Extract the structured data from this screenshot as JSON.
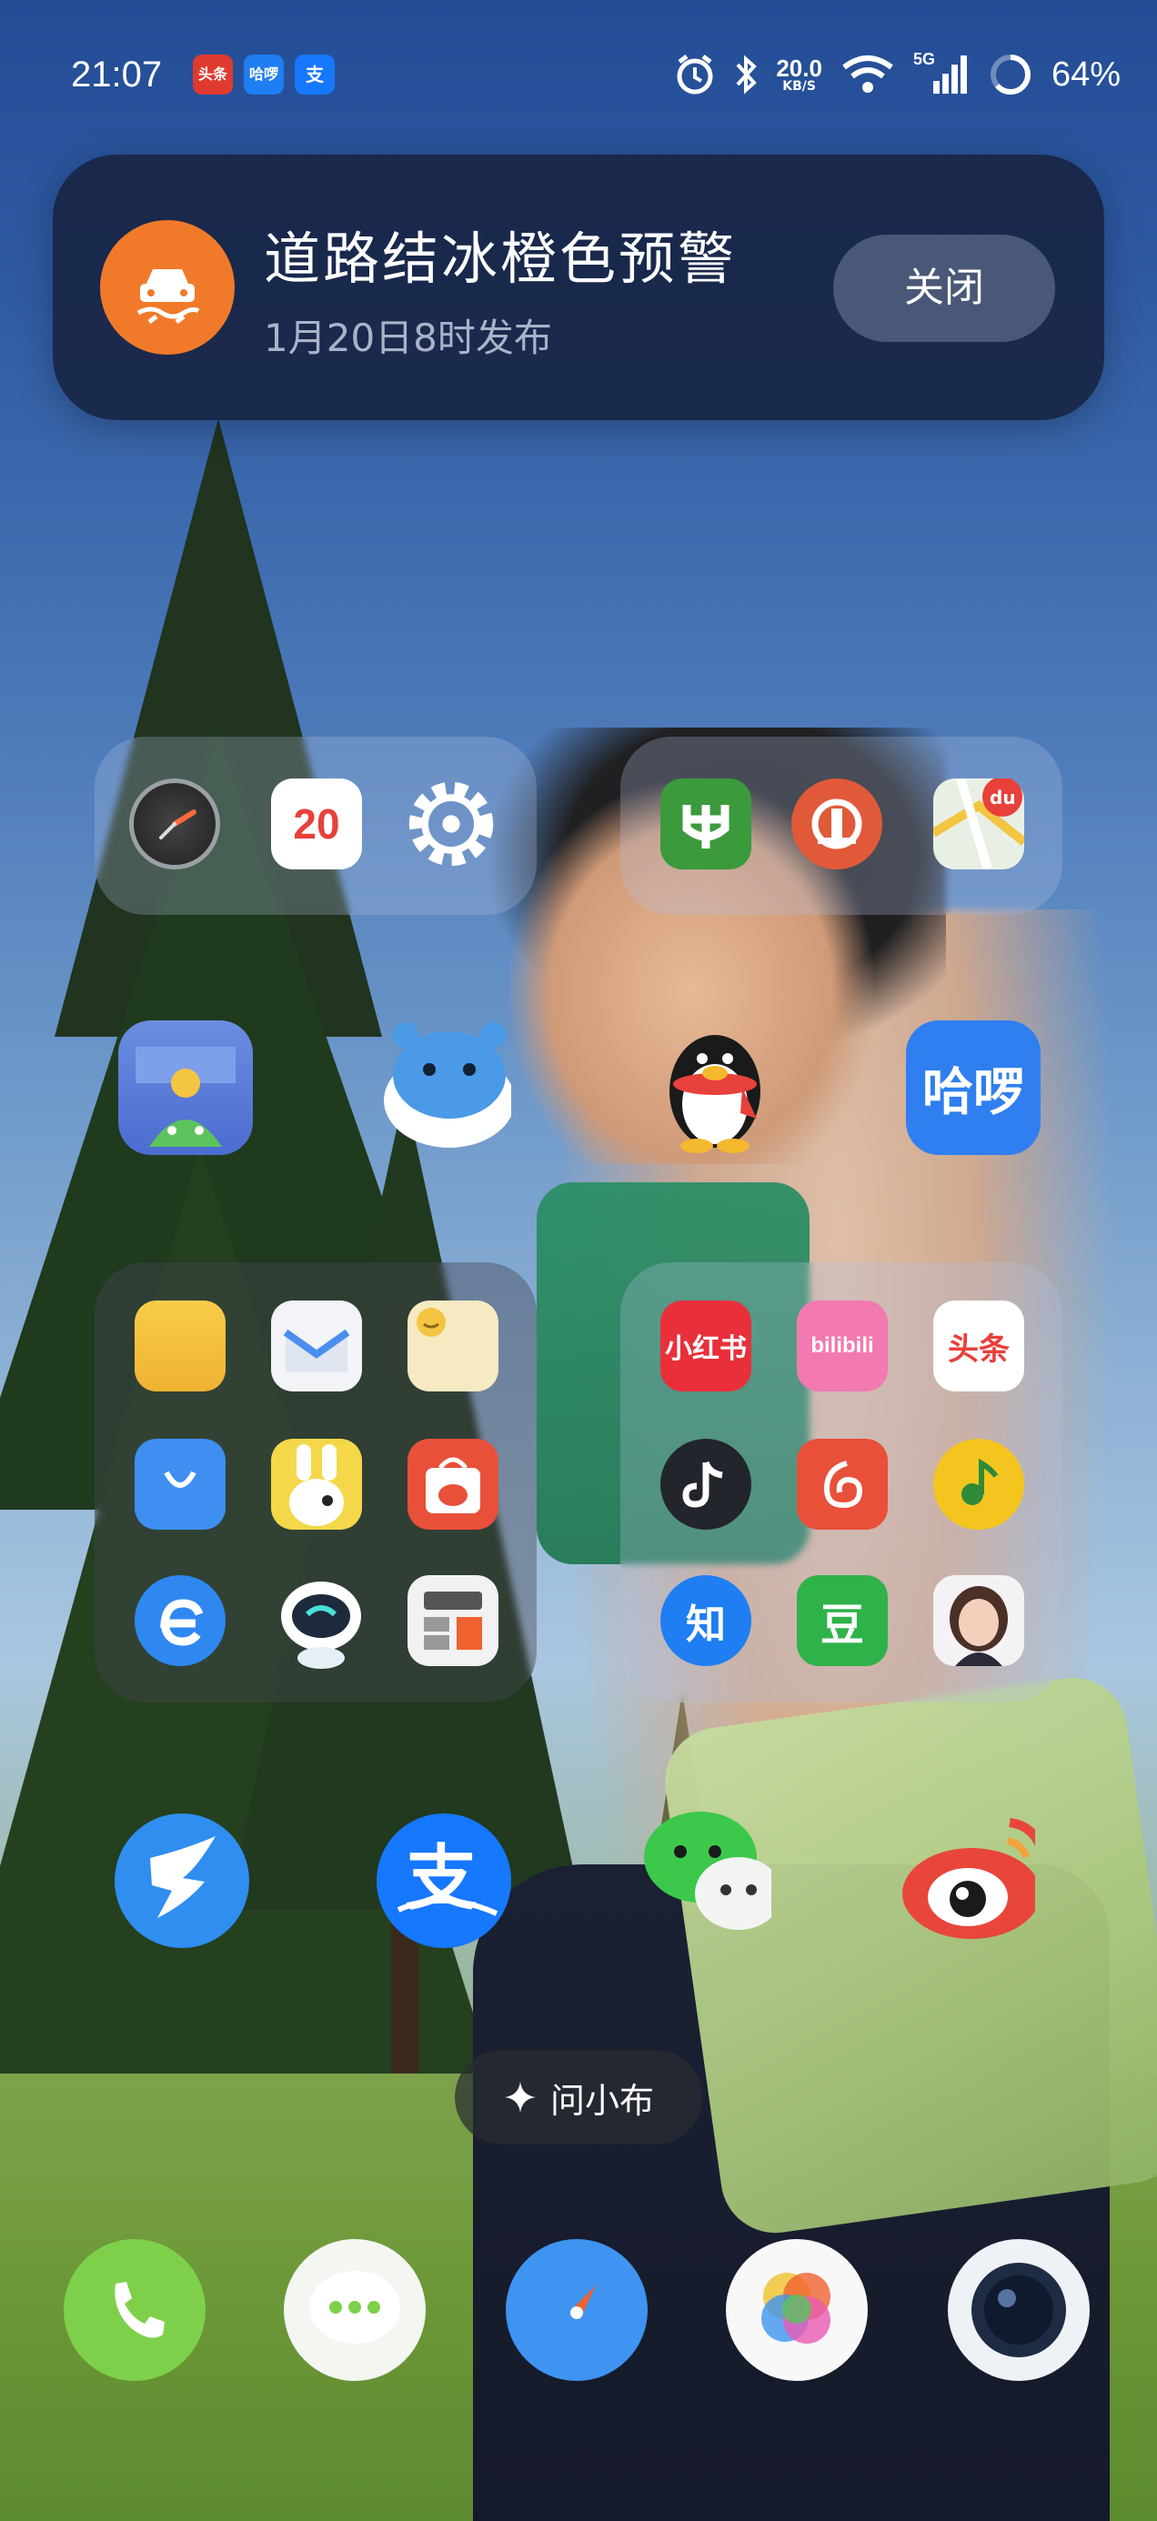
{
  "status_bar": {
    "time": "21:07",
    "apps": [
      {
        "name": "toutiao",
        "label": "头条",
        "color": "#e03a2f"
      },
      {
        "name": "hellobike",
        "label": "哈啰",
        "color": "#1f7ef2"
      },
      {
        "name": "alipay",
        "label": "支",
        "color": "#1677ff"
      }
    ],
    "net_speed": "20.0",
    "net_unit": "KB/S",
    "signal": "5G",
    "battery": "64%",
    "battery_level": 0.64
  },
  "notification": {
    "title": "道路结冰橙色预警",
    "subtitle": "1月20日8时发布",
    "close_label": "关闭",
    "accent": "#f07a2a"
  },
  "calendar_icon": {
    "day": "20"
  },
  "hello_icon": {
    "label": "哈啰"
  },
  "folder_right_bottom": {
    "xhs": "小红书",
    "bilibili": "bilibili",
    "toutiao": "头条",
    "zhihu": "知",
    "douban": "豆"
  },
  "ask_bar": {
    "label": "问小布"
  }
}
